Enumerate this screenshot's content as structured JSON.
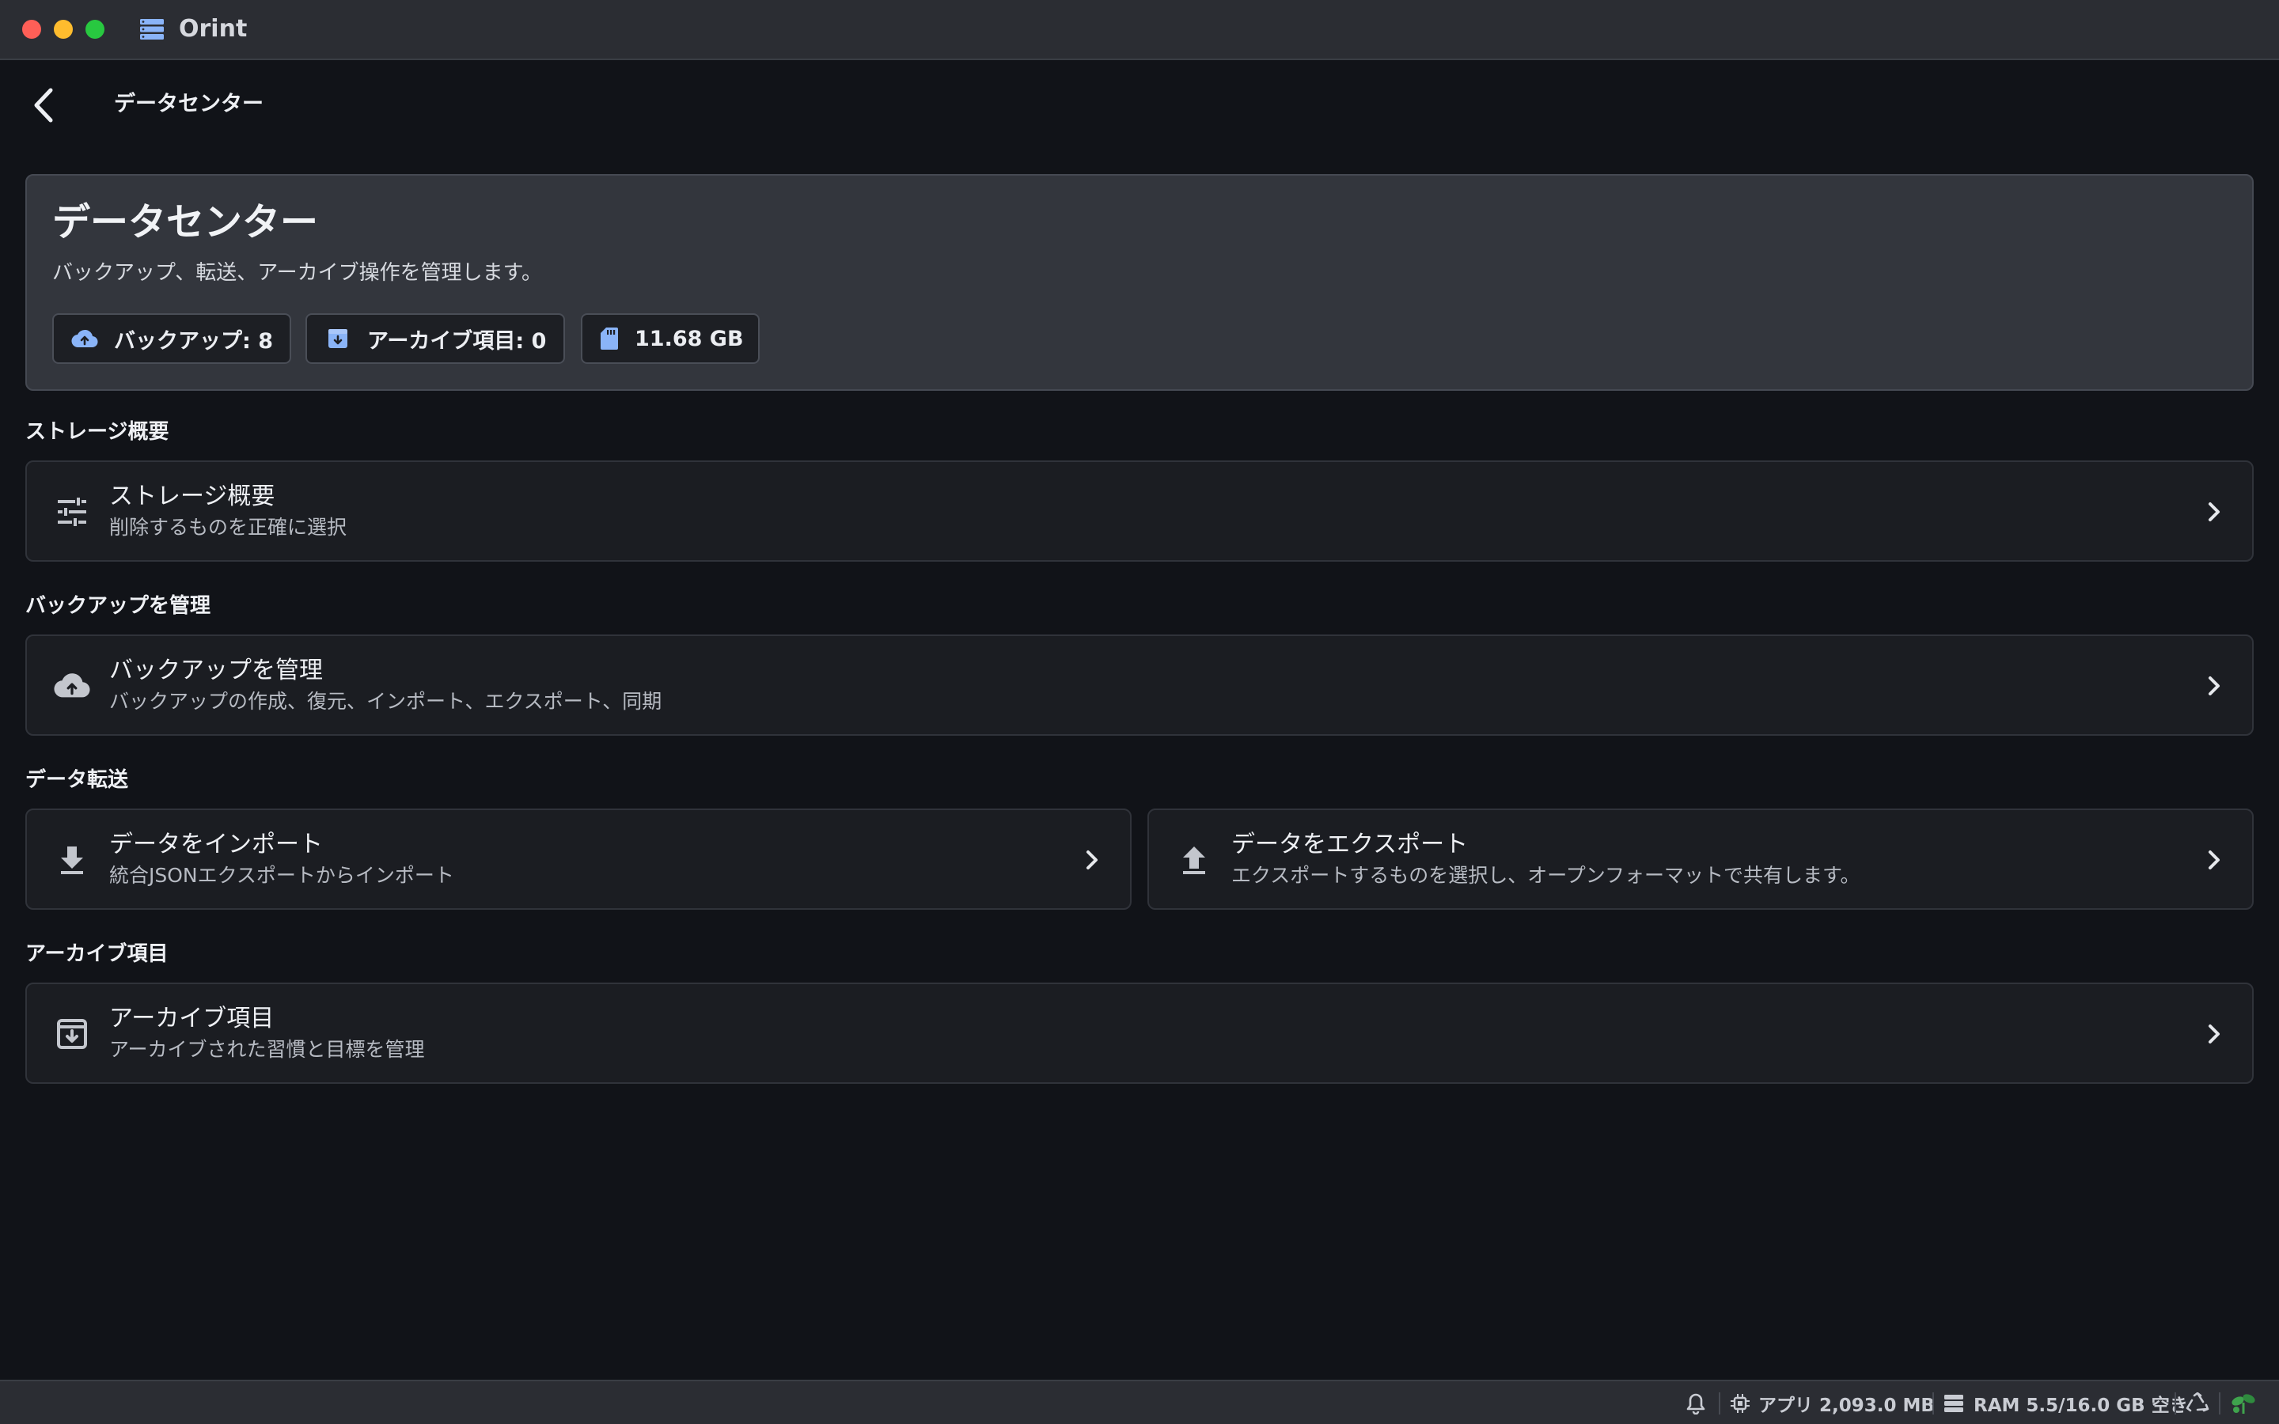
{
  "window": {
    "title": "Orint"
  },
  "nav": {
    "title": "データセンター"
  },
  "hero": {
    "title": "データセンター",
    "subtitle": "バックアップ、転送、アーカイブ操作を管理します。",
    "chips": [
      {
        "label": "バックアップ: 8",
        "icon": "cloud-upload-icon"
      },
      {
        "label": "アーカイブ項目: 0",
        "icon": "archive-icon"
      },
      {
        "label": "11.68 GB",
        "icon": "sd-card-icon"
      }
    ]
  },
  "sections": {
    "storage": {
      "label": "ストレージ概要",
      "title": "ストレージ概要",
      "subtitle": "削除するものを正確に選択",
      "icon": "sliders-icon"
    },
    "backup": {
      "label": "バックアップを管理",
      "title": "バックアップを管理",
      "subtitle": "バックアップの作成、復元、インポート、エクスポート、同期",
      "icon": "cloud-upload-icon"
    },
    "transfer": {
      "label": "データ転送",
      "import": {
        "title": "データをインポート",
        "subtitle": "統合JSONエクスポートからインポート",
        "icon": "download-icon"
      },
      "export": {
        "title": "データをエクスポート",
        "subtitle": "エクスポートするものを選択し、オープンフォーマットで共有します。",
        "icon": "upload-icon"
      }
    },
    "archive": {
      "label": "アーカイブ項目",
      "title": "アーカイブ項目",
      "subtitle": "アーカイブされた習慣と目標を管理",
      "icon": "archive-icon"
    }
  },
  "statusbar": {
    "app_memory": "アプリ 2,093.0 MB",
    "ram": "RAM 5.5/16.0 GB 空き"
  },
  "colors": {
    "background": "#111318",
    "card": "#1b1d22",
    "hero_card": "#33363d",
    "accent_blue": "#8ab4f8",
    "status_green": "#3fa34d"
  }
}
